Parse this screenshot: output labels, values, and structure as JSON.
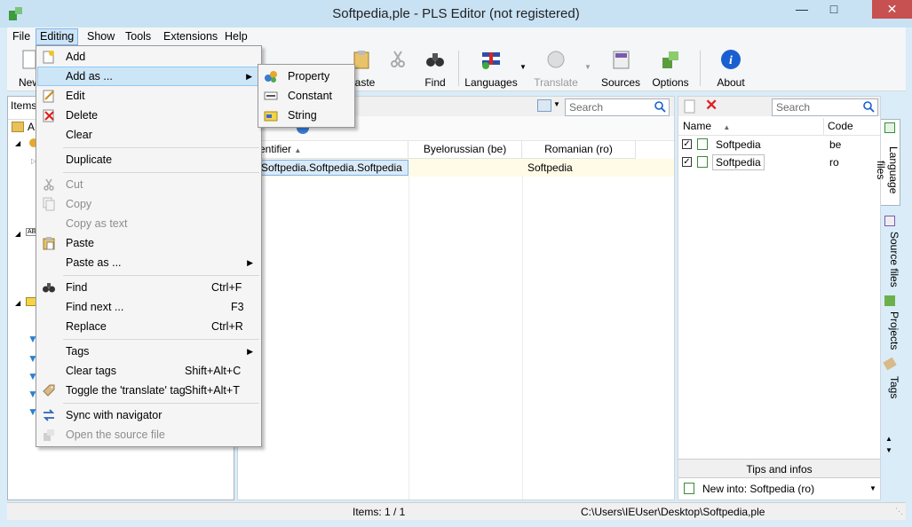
{
  "window": {
    "title": "Softpedia,ple - PLS Editor (not registered)"
  },
  "menubar": {
    "items": [
      "File",
      "Editing",
      "Show",
      "Tools",
      "Extensions",
      "Help"
    ]
  },
  "toolbar": {
    "new_label": "New",
    "paste_label": "Paste",
    "find_label": "Find",
    "languages_label": "Languages",
    "translate_label": "Translate",
    "sources_label": "Sources",
    "options_label": "Options",
    "about_label": "About"
  },
  "items_panel": {
    "header": "Items",
    "root_label": "A"
  },
  "center": {
    "search_placeholder": "Search",
    "columns": [
      "Identifier",
      "Byelorussian (be)",
      "Romanian (ro)"
    ],
    "row": {
      "identifier": "Softpedia.Softpedia.Softpedia",
      "be": "",
      "ro": "Softpedia"
    }
  },
  "right_panel": {
    "search_placeholder": "Search",
    "columns": [
      "Name",
      "Code"
    ],
    "rows": [
      {
        "name": "Softpedia",
        "code": "be",
        "checked": true
      },
      {
        "name": "Softpedia",
        "code": "ro",
        "checked": true
      }
    ],
    "tips_label": "Tips and infos",
    "new_into": "New into: Softpedia (ro)"
  },
  "side_tabs": [
    "Language files",
    "Source files",
    "Projects",
    "Tags"
  ],
  "editing_menu": {
    "add": "Add",
    "add_as": "Add as ...",
    "edit": "Edit",
    "delete": "Delete",
    "clear": "Clear",
    "duplicate": "Duplicate",
    "cut": "Cut",
    "copy": "Copy",
    "copy_as_text": "Copy as text",
    "paste": "Paste",
    "paste_as": "Paste as ...",
    "find": "Find",
    "find_shortcut": "Ctrl+F",
    "find_next": "Find next ...",
    "find_next_shortcut": "F3",
    "replace": "Replace",
    "replace_shortcut": "Ctrl+R",
    "tags": "Tags",
    "clear_tags": "Clear tags",
    "clear_tags_shortcut": "Shift+Alt+C",
    "toggle_translate_tag": "Toggle the 'translate' tag",
    "toggle_shortcut": "Shift+Alt+T",
    "sync_navigator": "Sync with navigator",
    "open_source_file": "Open the source file"
  },
  "add_as_submenu": {
    "property": "Property",
    "constant": "Constant",
    "string": "String"
  },
  "statusbar": {
    "items_count": "Items: 1 / 1",
    "path": "C:\\Users\\IEUser\\Desktop\\Softpedia,ple"
  },
  "colors": {
    "accent": "#0a64c8",
    "highlight": "#cde6f7",
    "close": "#c75050"
  }
}
